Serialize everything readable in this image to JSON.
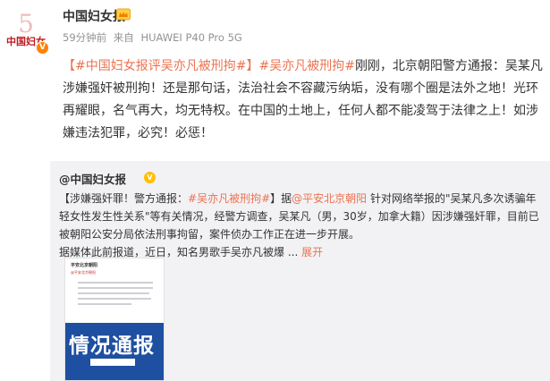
{
  "post": {
    "author": "中国妇女报",
    "time": "59分钟前",
    "source_prefix": "来自",
    "source_device": "HUAWEI P40 Pro 5G",
    "body": {
      "tag1": "【#中国妇女报评吴亦凡被刑拘#】",
      "tag2": "#吴亦凡被刑拘#",
      "text": "刚刚，北京朝阳警方通报：吴某凡涉嫌强奸被刑拘！还是那句话，法治社会不容藏污纳垢，没有哪个圈是法外之地！光环再耀眼，名气再大，均无特权。在中国的土地上，任何人都不能凌驾于法律之上！如涉嫌违法犯罪，必究！必惩！"
    }
  },
  "repost": {
    "author": "@中国妇女报",
    "tag_prefix": "【涉嫌强奸罪！警方通报：",
    "tag": "#吴亦凡被刑拘#",
    "tag_suffix": "】据",
    "link": "@平安北京朝阳",
    "text": " 针对网络举报的\"吴某凡多次诱骗年轻女性发生性关系\"等有关情况，经警方调查，吴某凡（男，30岁，加拿大籍）因涉嫌强奸罪，目前已被朝阳公安分局依法刑事拘留，案件侦办工作正在进一步开展。",
    "text2": "据媒体此前报道，近日，知名男歌手吴亦凡被爆 ... ",
    "expand": "展开",
    "thumb": {
      "title": "平安北京朝阳",
      "sub": "@平安北京朝阳",
      "banner": "情况通报"
    }
  },
  "colors": {
    "accent": "#eb7350",
    "meta": "#939393",
    "repost_bg": "#f2f2f5",
    "badge_blue": "#1f4fa0"
  }
}
